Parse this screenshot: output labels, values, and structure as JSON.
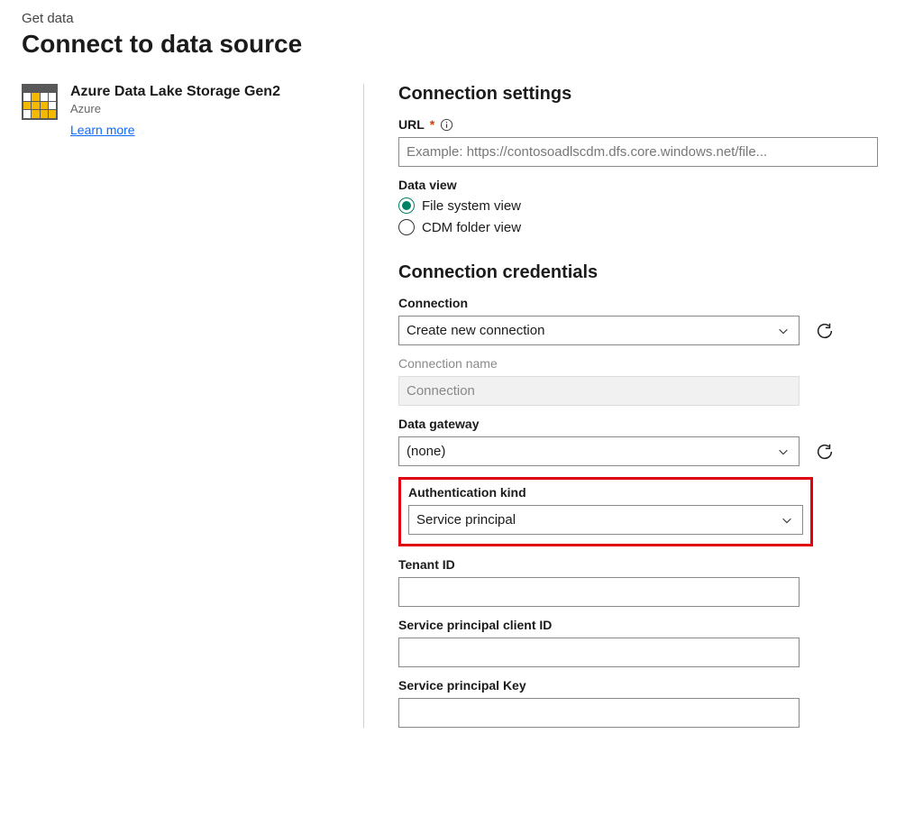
{
  "breadcrumb": "Get data",
  "page_title": "Connect to data source",
  "connector": {
    "title": "Azure Data Lake Storage Gen2",
    "subtitle": "Azure",
    "learn_more": "Learn more"
  },
  "settings": {
    "heading": "Connection settings",
    "url_label": "URL",
    "url_placeholder": "Example: https://contosoadlscdm.dfs.core.windows.net/file...",
    "data_view_label": "Data view",
    "radio_fs": "File system view",
    "radio_cdm": "CDM folder view"
  },
  "credentials": {
    "heading": "Connection credentials",
    "connection_label": "Connection",
    "connection_value": "Create new connection",
    "connection_name_label": "Connection name",
    "connection_name_value": "Connection",
    "gateway_label": "Data gateway",
    "gateway_value": "(none)",
    "auth_kind_label": "Authentication kind",
    "auth_kind_value": "Service principal",
    "tenant_label": "Tenant ID",
    "sp_client_label": "Service principal client ID",
    "sp_key_label": "Service principal Key"
  },
  "colors": {
    "accent_teal": "#008064",
    "highlight_red": "#e1000f",
    "link_blue": "#0b6cff"
  }
}
